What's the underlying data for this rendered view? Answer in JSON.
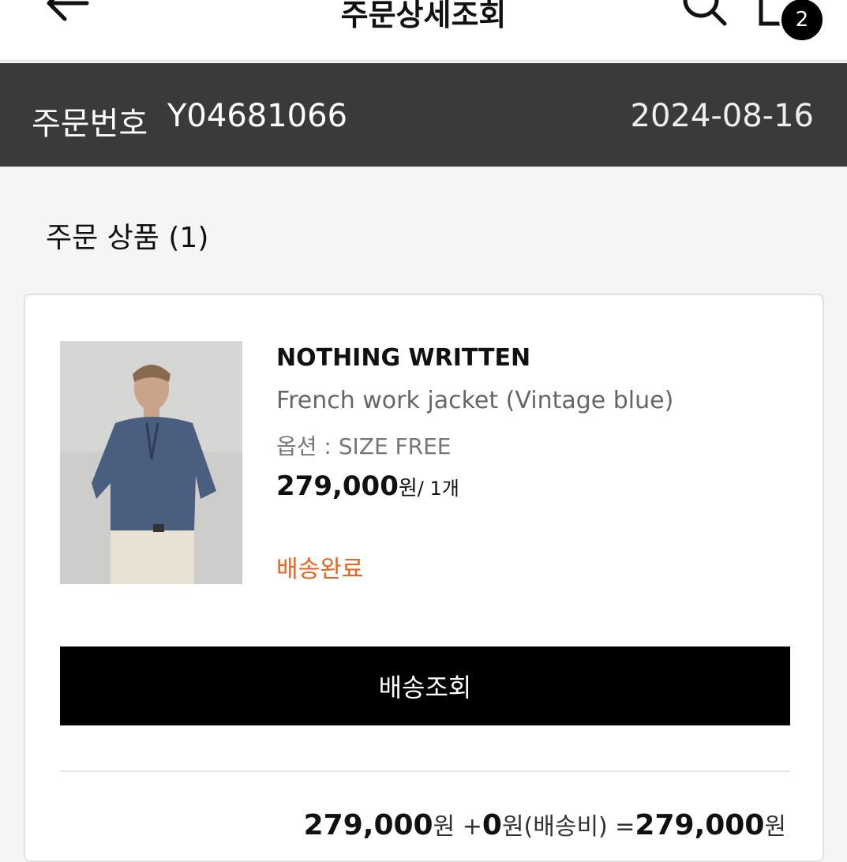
{
  "header": {
    "title": "주문상세조회",
    "back_icon": "arrow-left-icon",
    "search_icon": "search-icon",
    "cart_icon": "shopping-bag-icon",
    "cart_count": "2"
  },
  "order": {
    "label": "주문번호",
    "number": "Y04681066",
    "date": "2024-08-16"
  },
  "section": {
    "title": "주문 상품 (1)"
  },
  "item": {
    "brand": "NOTHING WRITTEN",
    "name": "French work jacket (Vintage blue)",
    "option": "옵션 : SIZE FREE",
    "price": "279,000",
    "price_unit": "원",
    "quantity": "/ 1개",
    "status": "배송완료",
    "status_color": "#e8641f"
  },
  "actions": {
    "track_label": "배송조회"
  },
  "summary": {
    "item_total": "279,000",
    "won1": "원 +",
    "shipping": "0",
    "shipping_label": "원(배송비) =",
    "grand_total": "279,000",
    "won2": "원"
  }
}
